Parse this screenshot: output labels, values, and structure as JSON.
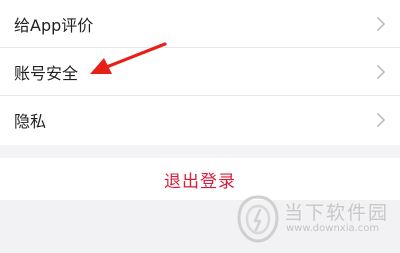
{
  "settings": {
    "items": [
      {
        "label": "给App评价"
      },
      {
        "label": "账号安全"
      },
      {
        "label": "隐私"
      }
    ],
    "logout_label": "退出登录",
    "accent_color": "#d81e3c"
  },
  "annotation": {
    "arrow_color": "#e8201a"
  },
  "watermark": {
    "name": "当下软件园",
    "url": "www.downxia.com"
  }
}
